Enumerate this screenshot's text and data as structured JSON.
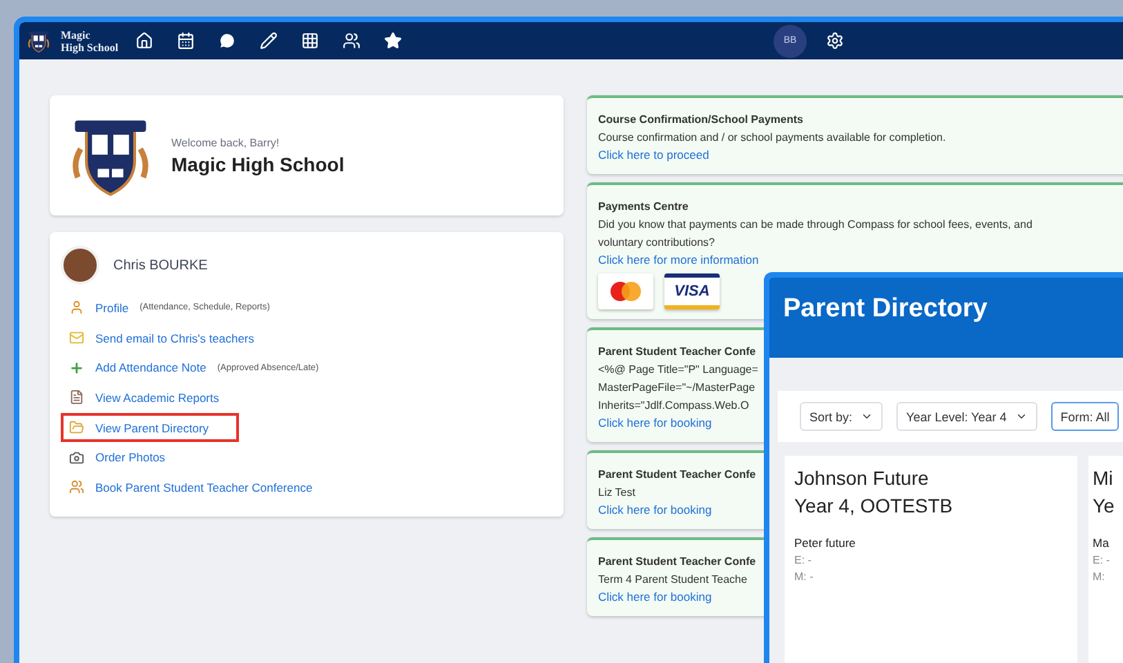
{
  "nav": {
    "brand": [
      "Magic",
      "High School"
    ],
    "avatar": "BB"
  },
  "school_card": {
    "welcome": "Welcome back, Barry!",
    "name": "Magic High School"
  },
  "student": {
    "name": "Chris BOURKE",
    "links": [
      {
        "kind": "profile",
        "label": "Profile",
        "note": "(Attendance, Schedule, Reports)",
        "highlighted": false
      },
      {
        "kind": "email",
        "label": "Send email to Chris's teachers",
        "highlighted": false
      },
      {
        "kind": "add",
        "label": "Add Attendance Note",
        "note": "(Approved Absence/Late)",
        "highlighted": false
      },
      {
        "kind": "reports",
        "label": "View Academic Reports",
        "highlighted": false
      },
      {
        "kind": "directory",
        "label": "View Parent Directory",
        "highlighted": true
      },
      {
        "kind": "photos",
        "label": "Order Photos",
        "highlighted": false
      },
      {
        "kind": "conference",
        "label": "Book Parent Student Teacher Conference",
        "highlighted": false
      }
    ]
  },
  "notices": [
    {
      "title": "Course Confirmation/School Payments",
      "lines": [
        "Course confirmation and / or school payments available for completion."
      ],
      "link": "Click here to proceed"
    },
    {
      "title": "Payments Centre",
      "lines": [
        "Did you know that payments can be made through Compass for school fees, events, and voluntary contributions?"
      ],
      "link": "Click here for more information",
      "cards": [
        {
          "kind": "mastercard"
        },
        {
          "kind": "visa",
          "label": "VISA"
        }
      ]
    },
    {
      "title": "Parent Student Teacher Confe",
      "lines": [
        "<%@ Page Title=\"P\" Language=",
        "MasterPageFile=\"~/MasterPage",
        "Inherits=\"Jdlf.Compass.Web.O"
      ],
      "link": "Click here for booking"
    },
    {
      "title": "Parent Student Teacher Confe",
      "lines": [
        "Liz Test"
      ],
      "link": "Click here for booking"
    },
    {
      "title": "Parent Student Teacher Confe",
      "lines": [
        "Term 4 Parent Student Teache"
      ],
      "link": "Click here for booking"
    }
  ],
  "directory": {
    "title": "Parent Directory",
    "filters": [
      {
        "label": "Sort by:",
        "focused": false,
        "caret": true
      },
      {
        "label": "Year Level: Year 4",
        "focused": false,
        "caret": true
      },
      {
        "label": "Form: All",
        "focused": true,
        "caret": false
      }
    ],
    "families": [
      {
        "student": "Johnson Future",
        "class": "Year 4, OOTESTB",
        "parent": "Peter future",
        "email": "E: -",
        "mobile": "M: -"
      },
      {
        "student": "Mi",
        "class": "Ye",
        "parent": "Ma",
        "email": "E: -",
        "mobile": "M:"
      }
    ]
  }
}
